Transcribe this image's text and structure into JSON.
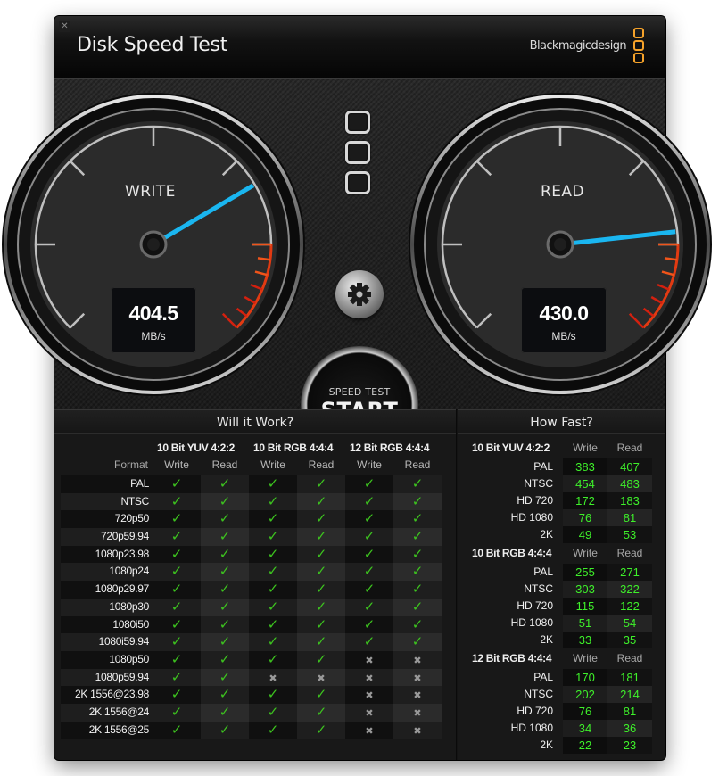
{
  "window": {
    "title": "Disk Speed Test",
    "brand": "Blackmagicdesign",
    "close_icon": "close-icon"
  },
  "gauges": {
    "write": {
      "label": "WRITE",
      "value": "404.5",
      "unit": "MB/s",
      "needle_fraction": 0.72
    },
    "read": {
      "label": "READ",
      "value": "430.0",
      "unit": "MB/s",
      "needle_fraction": 0.81
    }
  },
  "controls": {
    "settings_icon": "gear-icon",
    "start_small": "SPEED TEST",
    "start_big": "START"
  },
  "colors": {
    "needle": "#1ab6f0",
    "redline": "#e23a12",
    "check": "#3dc41f",
    "speed_value": "#3ef02a",
    "brand_accent": "#f5a22a"
  },
  "will_it_work": {
    "title": "Will it Work?",
    "format_header": "Format",
    "groups": [
      "10 Bit YUV 4:2:2",
      "10 Bit RGB 4:4:4",
      "12 Bit RGB 4:4:4"
    ],
    "sub_headers": [
      "Write",
      "Read",
      "Write",
      "Read",
      "Write",
      "Read"
    ],
    "rows": [
      {
        "format": "PAL",
        "cells": [
          1,
          1,
          1,
          1,
          1,
          1
        ]
      },
      {
        "format": "NTSC",
        "cells": [
          1,
          1,
          1,
          1,
          1,
          1
        ]
      },
      {
        "format": "720p50",
        "cells": [
          1,
          1,
          1,
          1,
          1,
          1
        ]
      },
      {
        "format": "720p59.94",
        "cells": [
          1,
          1,
          1,
          1,
          1,
          1
        ]
      },
      {
        "format": "1080p23.98",
        "cells": [
          1,
          1,
          1,
          1,
          1,
          1
        ]
      },
      {
        "format": "1080p24",
        "cells": [
          1,
          1,
          1,
          1,
          1,
          1
        ]
      },
      {
        "format": "1080p29.97",
        "cells": [
          1,
          1,
          1,
          1,
          1,
          1
        ]
      },
      {
        "format": "1080p30",
        "cells": [
          1,
          1,
          1,
          1,
          1,
          1
        ]
      },
      {
        "format": "1080i50",
        "cells": [
          1,
          1,
          1,
          1,
          1,
          1
        ]
      },
      {
        "format": "1080i59.94",
        "cells": [
          1,
          1,
          1,
          1,
          1,
          1
        ]
      },
      {
        "format": "1080p50",
        "cells": [
          1,
          1,
          1,
          1,
          0,
          0
        ]
      },
      {
        "format": "1080p59.94",
        "cells": [
          1,
          1,
          0,
          0,
          0,
          0
        ]
      },
      {
        "format": "2K 1556@23.98",
        "cells": [
          1,
          1,
          1,
          1,
          0,
          0
        ]
      },
      {
        "format": "2K 1556@24",
        "cells": [
          1,
          1,
          1,
          1,
          0,
          0
        ]
      },
      {
        "format": "2K 1556@25",
        "cells": [
          1,
          1,
          1,
          1,
          0,
          0
        ]
      }
    ]
  },
  "how_fast": {
    "title": "How Fast?",
    "write_label": "Write",
    "read_label": "Read",
    "groups": [
      {
        "name": "10 Bit YUV 4:2:2",
        "rows": [
          {
            "label": "PAL",
            "write": "383",
            "read": "407"
          },
          {
            "label": "NTSC",
            "write": "454",
            "read": "483"
          },
          {
            "label": "HD 720",
            "write": "172",
            "read": "183"
          },
          {
            "label": "HD 1080",
            "write": "76",
            "read": "81"
          },
          {
            "label": "2K",
            "write": "49",
            "read": "53"
          }
        ]
      },
      {
        "name": "10 Bit RGB 4:4:4",
        "rows": [
          {
            "label": "PAL",
            "write": "255",
            "read": "271"
          },
          {
            "label": "NTSC",
            "write": "303",
            "read": "322"
          },
          {
            "label": "HD 720",
            "write": "115",
            "read": "122"
          },
          {
            "label": "HD 1080",
            "write": "51",
            "read": "54"
          },
          {
            "label": "2K",
            "write": "33",
            "read": "35"
          }
        ]
      },
      {
        "name": "12 Bit RGB 4:4:4",
        "rows": [
          {
            "label": "PAL",
            "write": "170",
            "read": "181"
          },
          {
            "label": "NTSC",
            "write": "202",
            "read": "214"
          },
          {
            "label": "HD 720",
            "write": "76",
            "read": "81"
          },
          {
            "label": "HD 1080",
            "write": "34",
            "read": "36"
          },
          {
            "label": "2K",
            "write": "22",
            "read": "23"
          }
        ]
      }
    ]
  }
}
